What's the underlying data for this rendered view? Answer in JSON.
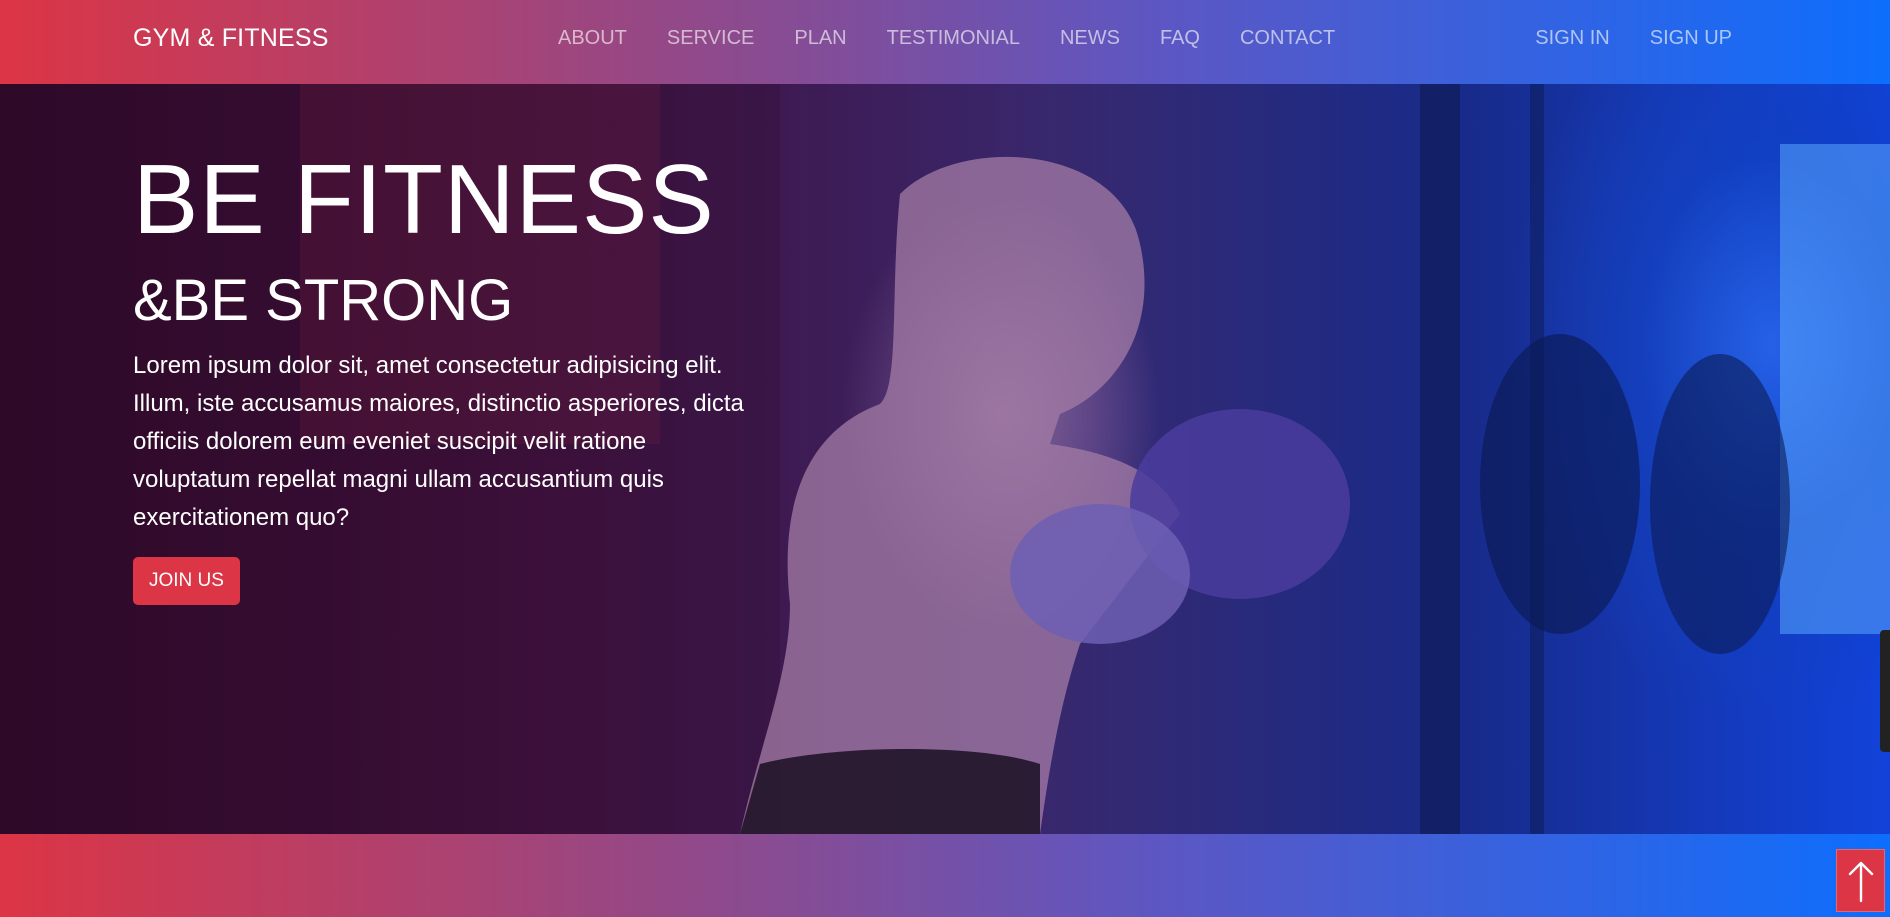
{
  "brand": {
    "name": "GYM & FITNESS"
  },
  "nav": {
    "links": [
      "ABOUT",
      "SERVICE",
      "PLAN",
      "TESTIMONIAL",
      "NEWS",
      "FAQ",
      "CONTACT"
    ],
    "auth": {
      "sign_in": "SIGN IN",
      "sign_up": "SIGN UP"
    }
  },
  "hero": {
    "title": "BE FITNESS",
    "subtitle": "&BE STRONG",
    "text": "Lorem ipsum dolor sit, amet consectetur adipisicing elit. Illum, iste accusamus maiores, distinctio asperiores, dicta officiis dolorem eum eveniet suscipit velit ratione voluptatum repellat magni ullam accusantium quis exercitationem quo?",
    "cta": "JOIN US"
  },
  "colors": {
    "accent": "#dc3545",
    "primary": "#0d6efd"
  },
  "icons": {
    "scroll_top": "arrow-up-icon"
  }
}
